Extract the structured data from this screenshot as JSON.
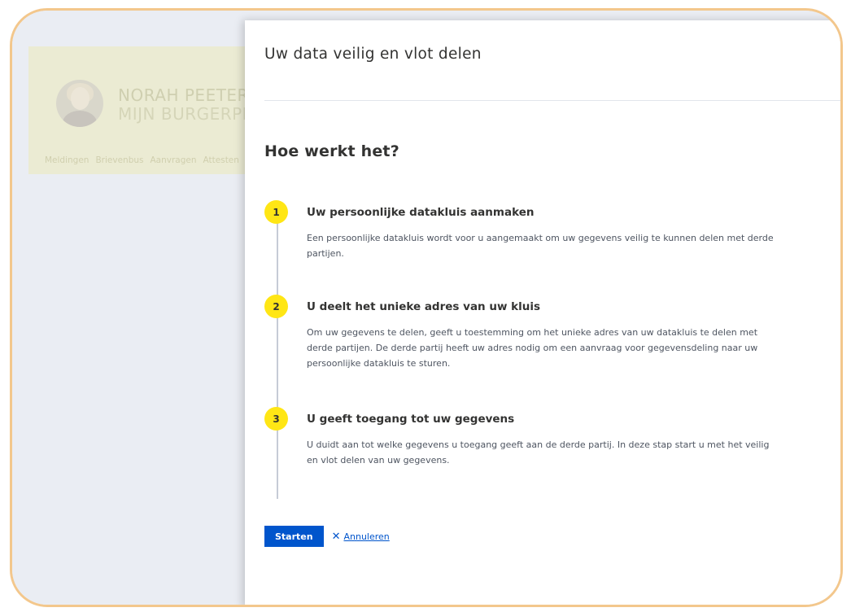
{
  "background": {
    "profile_name": "NORAH PEETERS",
    "profile_subtitle": "MIJN BURGERPROFIEL",
    "nav_tabs": [
      "Meldingen",
      "Brievenbus",
      "Aanvragen",
      "Attesten"
    ]
  },
  "panel": {
    "title": "Uw data veilig en vlot delen",
    "section_title": "Hoe werkt het?",
    "steps": [
      {
        "number": "1",
        "title": "Uw persoonlijke datakluis aanmaken",
        "description": "Een persoonlijke datakluis wordt voor u aangemaakt om uw gegevens veilig te kunnen delen met derde partijen."
      },
      {
        "number": "2",
        "title": "U deelt het unieke adres van uw kluis",
        "description": "Om uw gegevens te delen, geeft u toestemming om het unieke adres van uw datakluis te delen met derde partijen. De derde partij heeft uw adres nodig om een aanvraag voor gegevensdeling naar uw persoonlijke datakluis te sturen."
      },
      {
        "number": "3",
        "title": "U geeft toegang tot uw gegevens",
        "description": "U duidt aan tot welke gegevens u toegang geeft aan de derde partij. In deze stap start u met het veilig en vlot delen van uw gegevens."
      }
    ],
    "actions": {
      "start_label": "Starten",
      "cancel_label": "Annuleren",
      "cancel_icon": "close-icon"
    }
  },
  "colors": {
    "accent_yellow": "#ffe615",
    "primary_blue": "#0055cc",
    "frame_border": "#f3c78c"
  }
}
